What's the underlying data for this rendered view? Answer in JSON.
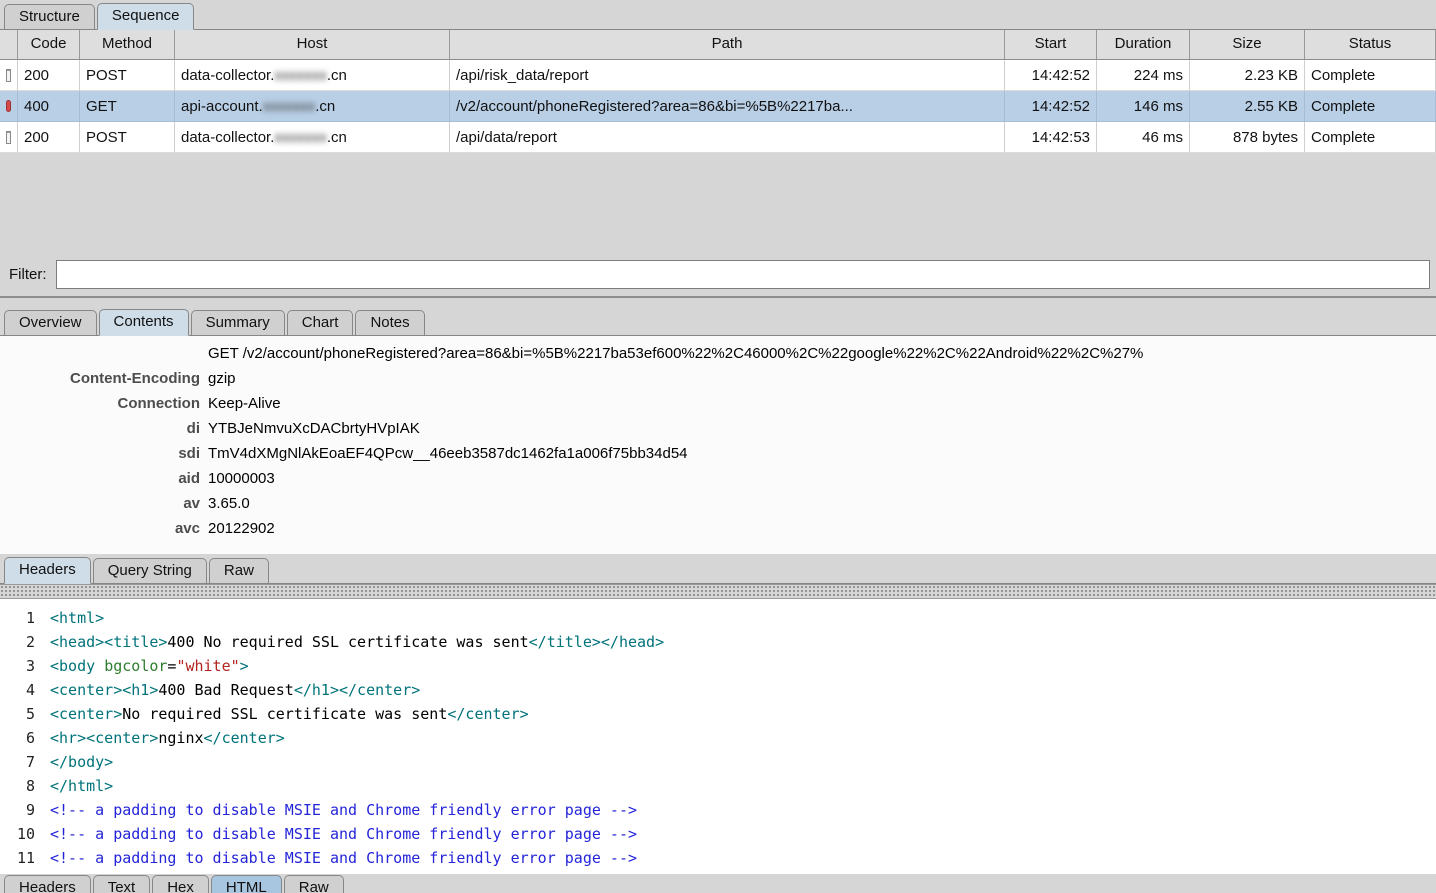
{
  "main_tabs": {
    "items": [
      {
        "label": "Structure",
        "selected": false
      },
      {
        "label": "Sequence",
        "selected": true
      }
    ]
  },
  "sequence_table": {
    "columns": [
      "",
      "Code",
      "Method",
      "Host",
      "Path",
      "Start",
      "Duration",
      "Size",
      "Status"
    ],
    "rows": [
      {
        "selected": false,
        "icon": "document-icon",
        "code": "200",
        "method": "POST",
        "host": {
          "prefix": "data-collector.",
          "redacted": "xxxxxxx",
          "suffix": ".cn"
        },
        "path": "/api/risk_data/report",
        "start": "14:42:52",
        "duration": "224 ms",
        "size": "2.23 KB",
        "status": "Complete"
      },
      {
        "selected": true,
        "icon": "error-icon",
        "code": "400",
        "method": "GET",
        "host": {
          "prefix": "api-account.",
          "redacted": "xxxxxxx",
          "suffix": ".cn"
        },
        "path": "/v2/account/phoneRegistered?area=86&bi=%5B%2217ba...",
        "start": "14:42:52",
        "duration": "146 ms",
        "size": "2.55 KB",
        "status": "Complete"
      },
      {
        "selected": false,
        "icon": "document-icon",
        "code": "200",
        "method": "POST",
        "host": {
          "prefix": "data-collector.",
          "redacted": "xxxxxxx",
          "suffix": ".cn"
        },
        "path": "/api/data/report",
        "start": "14:42:53",
        "duration": "46 ms",
        "size": "878 bytes",
        "status": "Complete"
      }
    ]
  },
  "filter": {
    "label": "Filter:",
    "value": ""
  },
  "detail_tabs": {
    "items": [
      {
        "label": "Overview",
        "selected": false
      },
      {
        "label": "Contents",
        "selected": true
      },
      {
        "label": "Summary",
        "selected": false
      },
      {
        "label": "Chart",
        "selected": false
      },
      {
        "label": "Notes",
        "selected": false
      }
    ]
  },
  "request_headers": {
    "request_line": "GET /v2/account/phoneRegistered?area=86&bi=%5B%2217ba53ef600%22%2C46000%2C%22google%22%2C%22Android%22%2C%27%",
    "rows": [
      {
        "name": "Content-Encoding",
        "value": "gzip"
      },
      {
        "name": "Connection",
        "value": "Keep-Alive"
      },
      {
        "name": "di",
        "value": "YTBJeNmvuXcDACbrtyHVpIAK"
      },
      {
        "name": "sdi",
        "value": "TmV4dXMgNlAkEoaEF4QPcw__46eeb3587dc1462fa1a006f75bb34d54"
      },
      {
        "name": "aid",
        "value": "10000003"
      },
      {
        "name": "av",
        "value": "3.65.0"
      },
      {
        "name": "avc",
        "value": "20122902"
      }
    ]
  },
  "headers_subtabs": {
    "items": [
      {
        "label": "Headers",
        "selected": true
      },
      {
        "label": "Query String",
        "selected": false
      },
      {
        "label": "Raw",
        "selected": false
      }
    ]
  },
  "response_body": {
    "lines": [
      {
        "num": "1",
        "segments": [
          {
            "t": "tag",
            "s": "<html>"
          }
        ]
      },
      {
        "num": "2",
        "segments": [
          {
            "t": "tag",
            "s": "<head><title>"
          },
          {
            "t": "text",
            "s": "400 No required SSL certificate was sent"
          },
          {
            "t": "tag",
            "s": "</title></head>"
          }
        ]
      },
      {
        "num": "3",
        "segments": [
          {
            "t": "tag",
            "s": "<body "
          },
          {
            "t": "attr",
            "s": "bgcolor"
          },
          {
            "t": "text",
            "s": "="
          },
          {
            "t": "val",
            "s": "\"white\""
          },
          {
            "t": "tag",
            "s": ">"
          }
        ]
      },
      {
        "num": "4",
        "segments": [
          {
            "t": "tag",
            "s": "<center><h1>"
          },
          {
            "t": "text",
            "s": "400 Bad Request"
          },
          {
            "t": "tag",
            "s": "</h1></center>"
          }
        ]
      },
      {
        "num": "5",
        "segments": [
          {
            "t": "tag",
            "s": "<center>"
          },
          {
            "t": "text",
            "s": "No required SSL certificate was sent"
          },
          {
            "t": "tag",
            "s": "</center>"
          }
        ]
      },
      {
        "num": "6",
        "segments": [
          {
            "t": "tag",
            "s": "<hr><center>"
          },
          {
            "t": "text",
            "s": "nginx"
          },
          {
            "t": "tag",
            "s": "</center>"
          }
        ]
      },
      {
        "num": "7",
        "segments": [
          {
            "t": "tag",
            "s": "</body>"
          }
        ]
      },
      {
        "num": "8",
        "segments": [
          {
            "t": "tag",
            "s": "</html>"
          }
        ]
      },
      {
        "num": "9",
        "segments": [
          {
            "t": "comment",
            "s": "<!-- a padding to disable MSIE and Chrome friendly error page -->"
          }
        ]
      },
      {
        "num": "10",
        "segments": [
          {
            "t": "comment",
            "s": "<!-- a padding to disable MSIE and Chrome friendly error page -->"
          }
        ]
      },
      {
        "num": "11",
        "segments": [
          {
            "t": "comment",
            "s": "<!-- a padding to disable MSIE and Chrome friendly error page -->"
          }
        ]
      }
    ]
  },
  "response_tabs": {
    "items": [
      {
        "label": "Headers",
        "selected": false
      },
      {
        "label": "Text",
        "selected": false
      },
      {
        "label": "Hex",
        "selected": false
      },
      {
        "label": "HTML",
        "selected": true
      },
      {
        "label": "Raw",
        "selected": false
      }
    ]
  },
  "colors": {
    "panel_bg": "#d6d6d6",
    "selected_row_bg": "#b9cfe6",
    "selected_tab_bg": "#cfdde9",
    "tag_color": "#00737a",
    "attr_color": "#2d7d2d",
    "value_color": "#b3231f",
    "comment_color": "#2424d8",
    "error_icon_color": "#d44a4a"
  }
}
